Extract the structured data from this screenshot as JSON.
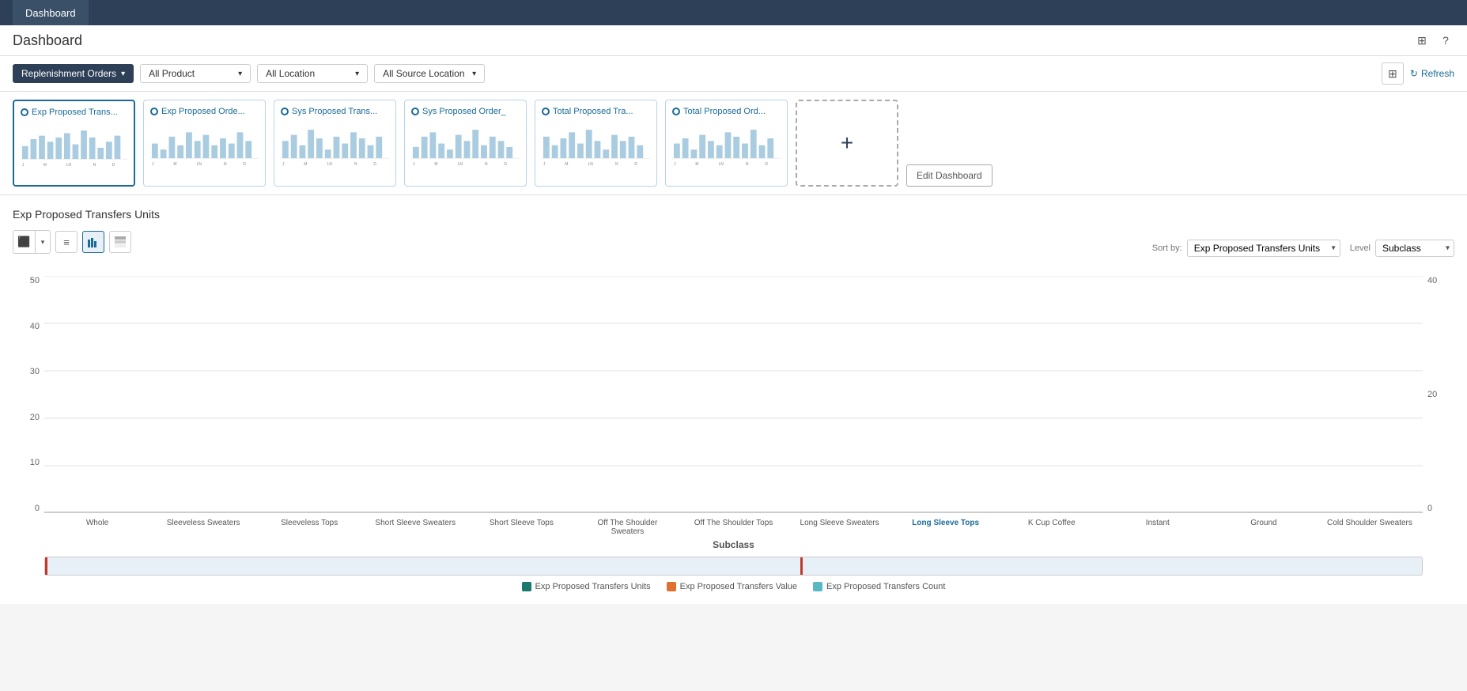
{
  "topNav": {
    "tab": "Dashboard"
  },
  "subHeader": {
    "title": "Dashboard"
  },
  "toolbar": {
    "replenishmentLabel": "Replenishment Orders",
    "productFilter": "All Product",
    "locationFilter": "All Location",
    "sourceLocationFilter": "All Source Location",
    "refreshLabel": "Refresh"
  },
  "metricCards": [
    {
      "id": "card1",
      "title": "Exp Proposed Trans...",
      "active": true
    },
    {
      "id": "card2",
      "title": "Exp Proposed Orde...",
      "active": false
    },
    {
      "id": "card3",
      "title": "Sys Proposed Trans...",
      "active": false
    },
    {
      "id": "card4",
      "title": "Sys Proposed Order_",
      "active": false
    },
    {
      "id": "card5",
      "title": "Total Proposed Tra...",
      "active": false
    },
    {
      "id": "card6",
      "title": "Total Proposed Ord...",
      "active": false
    }
  ],
  "addCard": {
    "plusSymbol": "+"
  },
  "editDashboard": {
    "label": "Edit Dashboard"
  },
  "chartSection": {
    "title": "Exp Proposed Transfers Units",
    "sortByLabel": "Sort by:",
    "sortByValue": "Exp Proposed Transfers Units",
    "levelLabel": "Level",
    "levelValue": "Subclass",
    "xAxisTitle": "Subclass"
  },
  "yAxis": {
    "left": [
      "50",
      "40",
      "30",
      "20",
      "10",
      "0"
    ],
    "right": [
      "40",
      "20",
      "0"
    ]
  },
  "xLabels": [
    "Whole",
    "Sleeveless Sweaters",
    "Sleeveless Tops",
    "Short Sleeve Sweaters",
    "Short Sleeve Tops",
    "Off The Shoulder Sweaters",
    "Off The Shoulder Tops",
    "Long Sleeve Sweaters",
    "Long Sleeve Tops",
    "K Cup Coffee",
    "Instant",
    "Ground",
    "Cold Shoulder Sweaters"
  ],
  "legend": [
    {
      "label": "Exp Proposed Transfers Units",
      "color": "#1a7a6e"
    },
    {
      "label": "Exp Proposed Transfers Value",
      "color": "#e07030"
    },
    {
      "label": "Exp Proposed Transfers Count",
      "color": "#5ab8c4"
    }
  ]
}
